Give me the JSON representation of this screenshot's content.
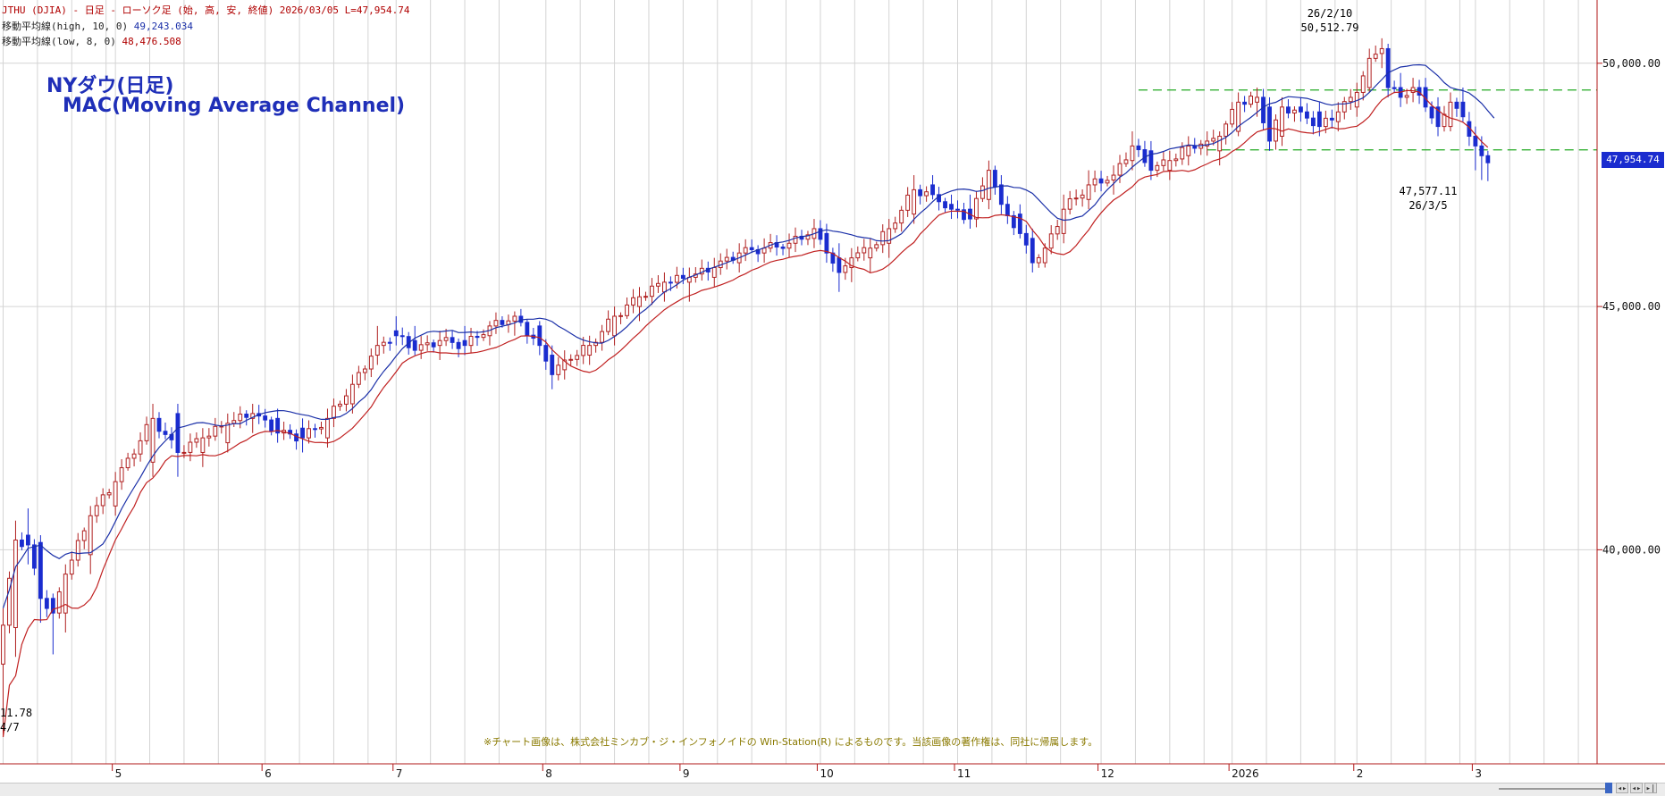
{
  "header": {
    "title_line": "JTHU (DJIA) - 日足 - ローソク足 (始, 高, 安, 終値) 2026/03/05 L=47,954.74",
    "ma_high_label": "移動平均線(high, 10, 0)",
    "ma_high_value": "49,243.034",
    "ma_low_label": "移動平均線(low, 8, 0)",
    "ma_low_value": "48,476.508"
  },
  "titles": {
    "line1": "NYダウ(日足)",
    "line2": "MAC(Moving Average Channel)"
  },
  "annotations": {
    "peak_date": "26/2/10",
    "peak_value": "50,512.79",
    "last_low_value": "47,577.11",
    "last_low_date": "26/3/5",
    "left_low_value": "11.78",
    "left_low_date": "4/7"
  },
  "price_box": "47,954.74",
  "credit": "※チャート画像は、株式会社ミンカブ・ジ・インフォノイドの Win-Station(R) によるものです。当該画像の著作権は、同社に帰属します。",
  "chart_data": {
    "type": "candlestick",
    "y_axis": {
      "min": 35600,
      "max": 51300,
      "tick_values": [
        40000,
        45000,
        50000
      ],
      "tick_labels": [
        "40,000.00",
        "45,000.00",
        "50,000.00"
      ]
    },
    "x_axis": {
      "month_labels": [
        "5",
        "6",
        "7",
        "8",
        "9",
        "10",
        "11",
        "12",
        "2026",
        "2",
        "3"
      ],
      "month_start_index": [
        18,
        42,
        63,
        87,
        109,
        131,
        153,
        176,
        197,
        217,
        236
      ]
    },
    "start_date": "2025-04-07",
    "ohlc_anchors": [
      [
        0,
        37650,
        38800,
        36150,
        38450
      ],
      [
        2,
        38400,
        40600,
        37800,
        40200
      ],
      [
        4,
        40300,
        40850,
        39700,
        40100
      ],
      [
        6,
        40150,
        40300,
        38500,
        39000
      ],
      [
        8,
        39000,
        39100,
        37850,
        38700
      ],
      [
        10,
        38700,
        39700,
        38300,
        39500
      ],
      [
        14,
        39900,
        40900,
        39500,
        40700
      ],
      [
        18,
        40900,
        41600,
        40700,
        41400
      ],
      [
        24,
        41800,
        43000,
        41500,
        42700
      ],
      [
        28,
        42800,
        43000,
        41500,
        42000
      ],
      [
        32,
        42000,
        42500,
        41700,
        42300
      ],
      [
        36,
        42200,
        42800,
        42000,
        42600
      ],
      [
        40,
        42700,
        43000,
        42400,
        42800
      ],
      [
        44,
        42700,
        42900,
        42200,
        42400
      ],
      [
        48,
        42500,
        42700,
        42000,
        42300
      ],
      [
        52,
        42300,
        42900,
        42100,
        42700
      ],
      [
        56,
        43000,
        43600,
        42800,
        43400
      ],
      [
        60,
        44000,
        44600,
        43800,
        44200
      ],
      [
        63,
        44500,
        44800,
        44200,
        44400
      ],
      [
        66,
        44300,
        44600,
        44000,
        44100
      ],
      [
        70,
        44200,
        44500,
        43900,
        44300
      ],
      [
        74,
        44300,
        44600,
        44000,
        44200
      ],
      [
        78,
        44400,
        44700,
        44200,
        44600
      ],
      [
        82,
        44700,
        44900,
        44400,
        44800
      ],
      [
        86,
        44600,
        44700,
        44000,
        44200
      ],
      [
        88,
        44000,
        44200,
        43300,
        43600
      ],
      [
        90,
        43700,
        44100,
        43500,
        43900
      ],
      [
        94,
        44000,
        44400,
        43800,
        44200
      ],
      [
        98,
        44400,
        45000,
        44200,
        44800
      ],
      [
        102,
        45000,
        45400,
        44700,
        45200
      ],
      [
        106,
        45300,
        45700,
        45100,
        45500
      ],
      [
        110,
        45500,
        45800,
        45100,
        45600
      ],
      [
        114,
        45600,
        46000,
        45400,
        45800
      ],
      [
        118,
        45900,
        46300,
        45700,
        46100
      ],
      [
        122,
        46100,
        46400,
        45900,
        46200
      ],
      [
        126,
        46200,
        46500,
        46000,
        46300
      ],
      [
        130,
        46400,
        46800,
        46200,
        46600
      ],
      [
        132,
        46500,
        46700,
        45900,
        46100
      ],
      [
        134,
        46000,
        46300,
        45300,
        45700
      ],
      [
        136,
        45800,
        46200,
        45500,
        46000
      ],
      [
        139,
        46000,
        46400,
        45700,
        46200
      ],
      [
        142,
        46300,
        46800,
        46000,
        46600
      ],
      [
        146,
        46900,
        47700,
        46700,
        47400
      ],
      [
        149,
        47500,
        47700,
        47200,
        47300
      ],
      [
        152,
        47100,
        47300,
        46800,
        47000
      ],
      [
        155,
        47000,
        47300,
        46600,
        46800
      ],
      [
        158,
        47200,
        48000,
        47000,
        47800
      ],
      [
        160,
        47500,
        47700,
        46900,
        47100
      ],
      [
        163,
        46900,
        47100,
        46400,
        46500
      ],
      [
        165,
        46400,
        46600,
        45700,
        45900
      ],
      [
        167,
        45900,
        46300,
        45800,
        46200
      ],
      [
        170,
        46500,
        47300,
        46300,
        47000
      ],
      [
        174,
        47200,
        47800,
        47000,
        47500
      ],
      [
        178,
        47600,
        47900,
        47300,
        47700
      ],
      [
        181,
        48000,
        48600,
        47800,
        48300
      ],
      [
        184,
        48200,
        48400,
        47600,
        47800
      ],
      [
        187,
        47800,
        48200,
        47600,
        48000
      ],
      [
        190,
        48100,
        48500,
        47900,
        48300
      ],
      [
        193,
        48300,
        48600,
        48100,
        48400
      ],
      [
        195,
        48200,
        48600,
        47900,
        48500
      ],
      [
        198,
        48600,
        49400,
        48500,
        49200
      ],
      [
        201,
        49200,
        49500,
        48900,
        49300
      ],
      [
        203,
        49100,
        49300,
        48200,
        48400
      ],
      [
        205,
        48500,
        49300,
        48300,
        49100
      ],
      [
        208,
        49100,
        49300,
        48800,
        49000
      ],
      [
        211,
        49000,
        49200,
        48500,
        48700
      ],
      [
        214,
        48800,
        49200,
        48600,
        49000
      ],
      [
        217,
        49100,
        49600,
        48900,
        49400
      ],
      [
        219,
        49500,
        50300,
        49400,
        50100
      ],
      [
        221,
        50200,
        50513,
        49900,
        50300
      ],
      [
        222,
        50300,
        50400,
        49300,
        49500
      ],
      [
        224,
        49500,
        49800,
        49100,
        49300
      ],
      [
        226,
        49400,
        49700,
        49200,
        49500
      ],
      [
        228,
        49500,
        49700,
        49000,
        49100
      ],
      [
        230,
        49100,
        49300,
        48500,
        48700
      ],
      [
        232,
        48700,
        49400,
        48600,
        49200
      ],
      [
        234,
        49200,
        49500,
        48800,
        48900
      ],
      [
        235,
        48800,
        49000,
        48300,
        48500
      ],
      [
        236,
        48500,
        48700,
        47800,
        48300
      ],
      [
        237,
        48300,
        48500,
        47600,
        48100
      ],
      [
        238,
        48100,
        48200,
        47577,
        47955
      ]
    ],
    "ma_high": {
      "period": 10,
      "last_value": 49243.034
    },
    "ma_low": {
      "period": 8,
      "last_value": 48476.508
    },
    "hlines": [
      {
        "value": 49450,
        "from_index": 182,
        "color": "#22aa22"
      },
      {
        "value": 48220,
        "from_index": 193,
        "color": "#22aa22"
      }
    ],
    "colors": {
      "up": "#b02020",
      "down": "#1a2ccf",
      "ma_high": "#1a2fa8",
      "ma_low": "#c02020",
      "grid": "#d4d4d4",
      "axis": "#b01818"
    }
  }
}
